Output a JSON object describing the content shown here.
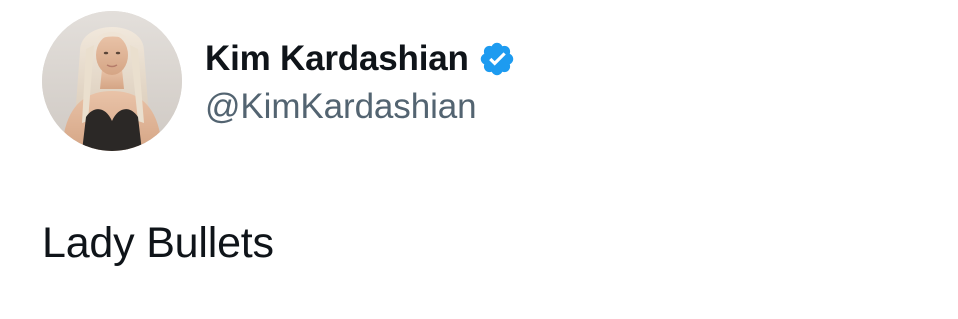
{
  "tweet": {
    "author": {
      "display_name": "Kim Kardashian",
      "handle": "@KimKardashian",
      "verified": true,
      "avatar_icon": "profile-photo-avatar",
      "verified_icon": "verified-badge-icon"
    },
    "text": "Lady Bullets"
  },
  "colors": {
    "text_primary": "#0f1419",
    "text_secondary": "#536471",
    "verified_blue": "#1d9bf0",
    "background": "#ffffff"
  }
}
